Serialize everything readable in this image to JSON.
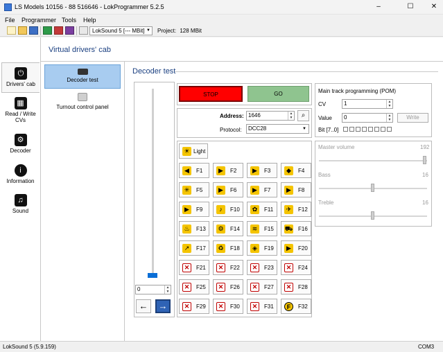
{
  "window": {
    "title": "LS Models 10156 - 88 516646 - LokProgrammer 5.2.5",
    "controls": [
      "–",
      "☐",
      "✕"
    ]
  },
  "menu": [
    "File",
    "Programmer",
    "Tools",
    "Help"
  ],
  "toolbar": {
    "decoder_combo": "LokSound 5 [--- MBit]",
    "project_label": "Project:",
    "project_value": "128 MBit"
  },
  "sidebar": [
    {
      "label": "Drivers' cab",
      "icon": "drivers-cab-icon",
      "glyph": "⏻"
    },
    {
      "label": "Read / Write CVs",
      "icon": "read-write-cvs-icon",
      "glyph": "▦"
    },
    {
      "label": "Decoder",
      "icon": "decoder-icon",
      "glyph": "⚙"
    },
    {
      "label": "Information",
      "icon": "information-icon",
      "glyph": "i"
    },
    {
      "label": "Sound",
      "icon": "sound-icon",
      "glyph": "♫"
    }
  ],
  "header": {
    "title": "Virtual drivers' cab"
  },
  "nav": [
    {
      "label": "Decoder test"
    },
    {
      "label": "Turnout control panel"
    }
  ],
  "section": {
    "title": "Decoder test"
  },
  "throttle": {
    "speed": "0",
    "reverse": "←",
    "forward": "→"
  },
  "control": {
    "stop": "STOP",
    "go": "GO",
    "address_label": "Address:",
    "address": "1646",
    "protocol_label": "Protocol:",
    "protocol": "DCC28"
  },
  "functions": {
    "light": "Light",
    "items": [
      "F1",
      "F2",
      "F3",
      "F4",
      "F5",
      "F6",
      "F7",
      "F8",
      "F9",
      "F10",
      "F11",
      "F12",
      "F13",
      "F14",
      "F15",
      "F16",
      "F17",
      "F18",
      "F19",
      "F20",
      "F21",
      "F22",
      "F23",
      "F24",
      "F25",
      "F26",
      "F27",
      "F28",
      "F29",
      "F30",
      "F31",
      "F32"
    ],
    "glyphs": [
      "◀",
      "▶",
      "▶",
      "◆",
      "✳",
      "▶",
      "▶",
      "▶",
      "▶",
      "♪",
      "✿",
      "✈",
      "♨",
      "⚙",
      "≋",
      "⛟",
      "↗",
      "♻",
      "◈",
      "▶",
      "✕",
      "✕",
      "✕",
      "✕",
      "✕",
      "✕",
      "✕",
      "✕",
      "✕",
      "✕",
      "✕",
      "F"
    ]
  },
  "pom": {
    "title": "Main track programming (POM)",
    "cv_label": "CV",
    "cv": "1",
    "value_label": "Value",
    "value": "0",
    "write": "Write",
    "bit_label": "Bit [7..0]"
  },
  "volume": {
    "master_label": "Master volume",
    "master": "192",
    "master_level": 1.0,
    "bass_label": "Bass",
    "bass": "16",
    "bass_level": 0.5,
    "treble_label": "Treble",
    "treble": "16",
    "treble_level": 0.5
  },
  "status": {
    "left": "LokSound 5 (5.9.159)",
    "right": "COM3"
  }
}
